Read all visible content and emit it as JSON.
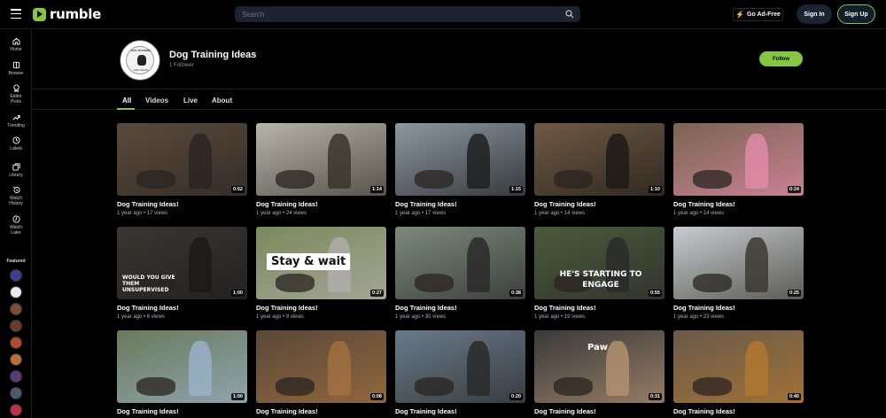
{
  "app": {
    "logo_text": "rumble",
    "search_placeholder": "Search",
    "ad_free_label": "Go Ad-Free",
    "sign_in_label": "Sign In",
    "sign_up_label": "Sign Up",
    "brand_color": "#85c742"
  },
  "sidebar": {
    "items": [
      {
        "label": "Home",
        "icon": "home-icon"
      },
      {
        "label": "Browse",
        "icon": "browse-icon"
      },
      {
        "label": "Editor Picks",
        "icon": "editor-picks-icon"
      },
      {
        "label": "Trending",
        "icon": "trending-icon"
      },
      {
        "label": "Latest",
        "icon": "clock-icon"
      },
      {
        "label": "Library",
        "icon": "library-icon"
      },
      {
        "label": "Watch History",
        "icon": "history-icon"
      },
      {
        "label": "Watch Later",
        "icon": "watch-later-icon"
      }
    ],
    "featured_label": "Featured",
    "featured_colors": [
      "#3b3f8f",
      "#e8e8f4",
      "#7a4d3a",
      "#6b3b2f",
      "#b34a2b",
      "#b8703a",
      "#5a3a7a",
      "#4a5a6a",
      "#c0304a"
    ]
  },
  "channel": {
    "title": "Dog Training Ideas",
    "followers": "1 Follower",
    "follow_label": "Follow",
    "avatar_text_top": "DOG TRAINING",
    "avatar_text_bottom": "DOG IDEAS"
  },
  "tabs": [
    {
      "label": "All",
      "active": true
    },
    {
      "label": "Videos",
      "active": false
    },
    {
      "label": "Live",
      "active": false
    },
    {
      "label": "About",
      "active": false
    }
  ],
  "videos": [
    {
      "title": "Dog Training Ideas!",
      "meta": "1 year ago • 17 views",
      "duration": "0:52",
      "bg": "#5a4a3c",
      "accent": "#2a2522",
      "overlay": ""
    },
    {
      "title": "Dog Training Ideas!",
      "meta": "1 year ago • 24 views",
      "duration": "1:14",
      "bg": "#b8b4ac",
      "accent": "#3a352c",
      "overlay": ""
    },
    {
      "title": "Dog Training Ideas!",
      "meta": "1 year ago • 17 views",
      "duration": "1:15",
      "bg": "#8c98a2",
      "accent": "#1e1e1e",
      "overlay": ""
    },
    {
      "title": "Dog Training Ideas!",
      "meta": "1 year ago • 14 views",
      "duration": "1:10",
      "bg": "#6e5a44",
      "accent": "#1e1a18",
      "overlay": ""
    },
    {
      "title": "Dog Training Ideas!",
      "meta": "1 year ago • 14 views",
      "duration": "0:24",
      "bg": "#7a6452",
      "accent": "#e08aa8",
      "overlay": ""
    },
    {
      "title": "Dog Training Ideas!",
      "meta": "1 year ago • 6 views",
      "duration": "1:00",
      "bg": "#3a3632",
      "accent": "#1c1a18",
      "overlay": "WOULD YOU GIVE THEM UNSUPERVISED"
    },
    {
      "title": "Dog Training Ideas!",
      "meta": "1 year ago • 9 views",
      "duration": "0:27",
      "bg": "#7a8a5c",
      "accent": "#b0ada8",
      "overlay": "Stay & wait"
    },
    {
      "title": "Dog Training Ideas!",
      "meta": "1 year ago • 30 views",
      "duration": "0:38",
      "bg": "#7c8a7c",
      "accent": "#2a2a2a",
      "overlay": ""
    },
    {
      "title": "Dog Training Ideas!",
      "meta": "1 year ago • 19 views",
      "duration": "0:55",
      "bg": "#4a5a3a",
      "accent": "#2a2a2a",
      "overlay": "HE'S STARTING TO ENGAGE"
    },
    {
      "title": "Dog Training Ideas!",
      "meta": "1 year ago • 23 views",
      "duration": "0:25",
      "bg": "#c8cbd0",
      "accent": "#3a3a30",
      "overlay": ""
    },
    {
      "title": "Dog Training Ideas!",
      "meta": "",
      "duration": "1:00",
      "bg": "#6a7a5a",
      "accent": "#9ab0c8",
      "overlay": ""
    },
    {
      "title": "Dog Training Ideas!",
      "meta": "",
      "duration": "0:08",
      "bg": "#5a4838",
      "accent": "#a07040",
      "overlay": ""
    },
    {
      "title": "Dog Training Ideas!",
      "meta": "",
      "duration": "0:20",
      "bg": "#6a7a8a",
      "accent": "#2a2a2a",
      "overlay": ""
    },
    {
      "title": "Dog Training Ideas!",
      "meta": "",
      "duration": "0:31",
      "bg": "#3a3a3a",
      "accent": "#b09070",
      "overlay": "Paw"
    },
    {
      "title": "Dog Training Ideas!",
      "meta": "",
      "duration": "0:40",
      "bg": "#6a5a4a",
      "accent": "#b07830",
      "overlay": ""
    }
  ]
}
